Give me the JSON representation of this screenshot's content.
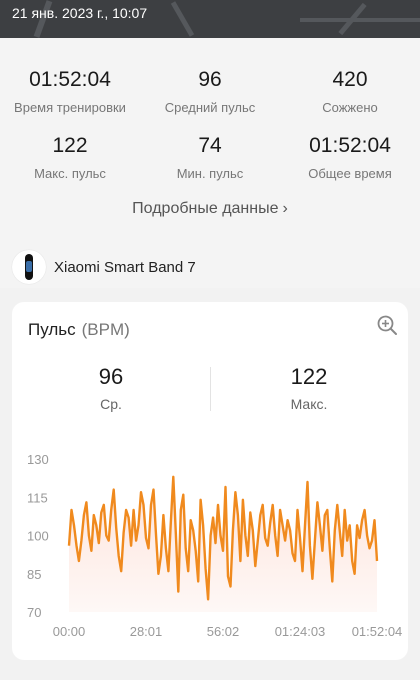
{
  "header": {
    "datetime": "21 янв. 2023 г., 10:07"
  },
  "stats": [
    {
      "value": "01:52:04",
      "label": "Время тренировки"
    },
    {
      "value": "96",
      "label": "Средний пульс"
    },
    {
      "value": "420",
      "label": "Сожжено"
    },
    {
      "value": "122",
      "label": "Макс. пульс"
    },
    {
      "value": "74",
      "label": "Мин. пульс"
    },
    {
      "value": "01:52:04",
      "label": "Общее время"
    }
  ],
  "details_link": "Подробные данные",
  "device": {
    "name": "Xiaomi Smart Band 7"
  },
  "heart_rate": {
    "title": "Пульс",
    "unit": "(BPM)",
    "avg_value": "96",
    "avg_label": "Ср.",
    "max_value": "122",
    "max_label": "Макс."
  },
  "chart_data": {
    "type": "area",
    "ylim": [
      70,
      130
    ],
    "yticks": [
      "130",
      "115",
      "100",
      "85",
      "70"
    ],
    "xticks": [
      "00:00",
      "28:01",
      "56:02",
      "01:24:03",
      "01:52:04"
    ],
    "line_color": "#f08a1e",
    "fill_color": "#fde3db",
    "series": [
      {
        "values": [
          96,
          110,
          104,
          96,
          90,
          98,
          108,
          113,
          100,
          94,
          108,
          104,
          97,
          109,
          112,
          100,
          98,
          110,
          118,
          103,
          92,
          86,
          101,
          110,
          107,
          96,
          110,
          98,
          104,
          117,
          112,
          99,
          95,
          112,
          118,
          101,
          85,
          92,
          108,
          95,
          86,
          105,
          123,
          101,
          78,
          110,
          116,
          95,
          86,
          106,
          102,
          94,
          82,
          114,
          104,
          87,
          75,
          100,
          107,
          97,
          112,
          100,
          94,
          119,
          84,
          80,
          102,
          117,
          108,
          90,
          114,
          100,
          92,
          109,
          102,
          88,
          98,
          108,
          112,
          99,
          96,
          105,
          112,
          100,
          92,
          110,
          104,
          98,
          106,
          102,
          93,
          90,
          110,
          99,
          86,
          104,
          121,
          96,
          83,
          98,
          113,
          104,
          94,
          108,
          110,
          95,
          82,
          102,
          112,
          102,
          92,
          110,
          98,
          104,
          90,
          85,
          104,
          99,
          106,
          110,
          100,
          95,
          98,
          106,
          90
        ]
      }
    ]
  }
}
